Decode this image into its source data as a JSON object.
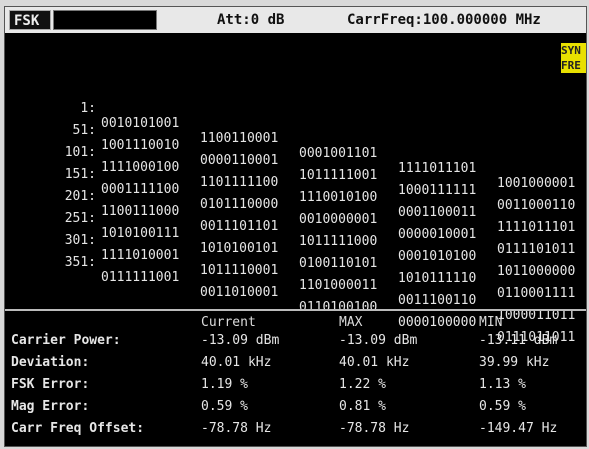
{
  "topbar": {
    "mode": "FSK",
    "attenuation": "Att:0 dB",
    "carrier_freq": "CarrFreq:100.000000 MHz"
  },
  "sync_badge": {
    "line1": "SYN",
    "line2": "FRE"
  },
  "bits": [
    {
      "index": "1:",
      "groups": [
        "0010101001",
        "1100110001",
        "0001001101",
        "1111011101",
        "1001000001"
      ]
    },
    {
      "index": "51:",
      "groups": [
        "1001110010",
        "0000110001",
        "1011111001",
        "1000111111",
        "0011000110"
      ]
    },
    {
      "index": "101:",
      "groups": [
        "1111000100",
        "1101111100",
        "1110010100",
        "0001100011",
        "1111011101"
      ]
    },
    {
      "index": "151:",
      "groups": [
        "0001111100",
        "0101110000",
        "0010000001",
        "0000010001",
        "0111101011"
      ]
    },
    {
      "index": "201:",
      "groups": [
        "1100111000",
        "0011101101",
        "1011111000",
        "0001010100",
        "1011000000"
      ]
    },
    {
      "index": "251:",
      "groups": [
        "1010100111",
        "1010100101",
        "0100110101",
        "1010111110",
        "0110001111"
      ]
    },
    {
      "index": "301:",
      "groups": [
        "1111010001",
        "1011110001",
        "1101000011",
        "0011100110",
        "1000011011"
      ]
    },
    {
      "index": "351:",
      "groups": [
        "0111111001",
        "0011010001",
        "0110100100",
        "0000100000",
        "0111011011"
      ]
    }
  ],
  "measurements": {
    "headers": {
      "current": "Current",
      "max": "MAX",
      "min": "MIN"
    },
    "rows": [
      {
        "label": "Carrier Power:",
        "current": "-13.09 dBm",
        "max": "-13.09 dBm",
        "min": "-13.11 dBm"
      },
      {
        "label": "Deviation:",
        "current": "40.01 kHz",
        "max": "40.01 kHz",
        "min": "39.99 kHz"
      },
      {
        "label": "FSK Error:",
        "current": "1.19 %",
        "max": "1.22 %",
        "min": "1.13 %"
      },
      {
        "label": "Mag Error:",
        "current": "0.59 %",
        "max": "0.81 %",
        "min": "0.59 %"
      },
      {
        "label": "Carr Freq Offset:",
        "current": "-78.78 Hz",
        "max": "-78.78 Hz",
        "min": "-149.47 Hz"
      }
    ]
  }
}
